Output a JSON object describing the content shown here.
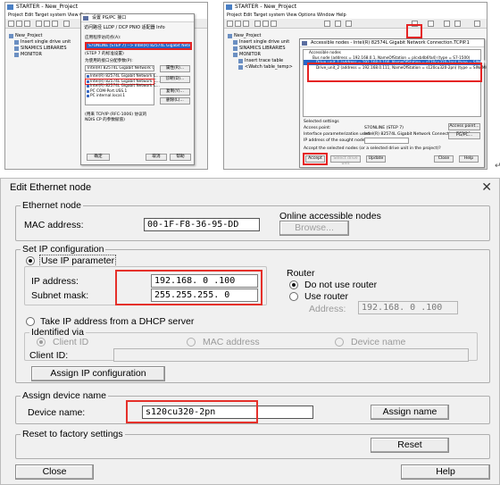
{
  "thumb_left": {
    "app_title": "STARTER - New_Project",
    "menu": "Project  Edit  Target system  View  Options",
    "tree": [
      "New_Project",
      "Insert single drive unit",
      "SINAMICS LIBRARIES",
      "MONITOR"
    ],
    "dialog_title": "设置 PG/PC 接口",
    "tabs": "访问路径  LLDP / DCP  PNIO 适配器  Info",
    "access_point_label": "应用程序访问点(A):",
    "access_point_value": "S7ONLINE (STEP 7)    --> Intel(R) 82574L Gigabit Network Conn",
    "std_label": "(STEP 7 的标准设置)",
    "param_label": "为使用的接口分配参数(P):",
    "param_value": "Intel(R) 82574L Gigabit Network Connect",
    "list_items": [
      "Intel(R) 82574L Gigabit Network C...",
      "Intel(R) 82574L Gigabit Network C...",
      "Intel(R) 82574L Gigabit Network C...",
      "PC COM-Port.USS.1",
      "PC internal.local.1"
    ],
    "side_buttons": [
      "属性(R)...",
      "诊断(D)...",
      "复制(Y)...",
      "删除(L)..."
    ],
    "desc": "(用来 TCP/IP (RFC-1006) 协议的 NDIS CP 的参数赋值)",
    "ok": "确定",
    "cancel": "取消",
    "help": "帮助"
  },
  "thumb_right": {
    "app_title": "STARTER - New_Project",
    "menu": "Project  Edit  Target system  View  Options  Window  Help",
    "tree": [
      "New_Project",
      "Insert single drive unit",
      "SINAMICS LIBRARIES",
      "MONITOR",
      "Insert trace table",
      "<Watch table_temp>"
    ],
    "dialog_title": "Accessible nodes - Intel(R) 82574L Gigabit Network Connection.TCPIP.1",
    "nodes": [
      "Accessible nodes",
      "Bus node (address = 192.168.0.1, NameOfStation = plcxb4b6fa4) (type = S7-1500)",
      "Drive_unit_1 (address = 192.168.0.100, NameOfStation = s120cu320-2pn) (type = SINAMICS S120/CU320-2PN V5.2)",
      "Drive_unit_2 (address = 192.168.0.111, NameOfStation = s120cu320-2pn) (type = SINAMICS S120/CU320-2PN V5.2)"
    ],
    "settings_title": "Selected settings",
    "access_point_label": "Access point:",
    "access_point_value": "S7ONLINE (STEP 7)",
    "iface_label": "Interface parameterization used:",
    "iface_value": "Intel(R) 82574L Gigabit Network Connection.TCPIP.1",
    "ip_label": "IP address of the sought node:",
    "question": "Accept the selected nodes (or a selected drive unit in the project)?",
    "btn_access_point": "Access point...",
    "btn_pgpc": "PG/PC...",
    "btn_accept": "Accept",
    "btn_select_drive": "Select drive unit",
    "btn_update": "Update",
    "btn_close": "Close",
    "btn_help": "Help"
  },
  "dialog": {
    "title": "Edit Ethernet node",
    "ethernet_node": {
      "group_label": "Ethernet node",
      "mac_label": "MAC address:",
      "mac_value": "00-1F-F8-36-95-DD",
      "online_label": "Online accessible nodes",
      "browse_label": "Browse..."
    },
    "set_ip": {
      "group_label": "Set IP configuration",
      "use_ip_label": "Use IP parameter",
      "ip_label": "IP address:",
      "ip_value": "192.168. 0 .100",
      "mask_label": "Subnet mask:",
      "mask_value": "255.255.255. 0",
      "router_label": "Router",
      "no_router_label": "Do not use router",
      "use_router_label": "Use router",
      "router_address_label": "Address:",
      "router_address_value": "192.168. 0 .100",
      "dhcp_label": "Take IP address from a DHCP server",
      "identified_label": "Identified via",
      "client_id_radio": "Client ID",
      "mac_radio": "MAC address",
      "device_name_radio": "Device name",
      "client_id_label": "Client ID:",
      "client_id_value": "",
      "assign_ip_button": "Assign IP configuration"
    },
    "assign_name": {
      "group_label": "Assign device name",
      "device_name_label": "Device name:",
      "device_name_value": "s120cu320-2pn",
      "assign_button": "Assign name"
    },
    "reset": {
      "group_label": "Reset to factory settings",
      "reset_button": "Reset"
    },
    "close_button": "Close",
    "help_button": "Help"
  },
  "colors": {
    "highlight": "#e5302a",
    "selection": "#2867c9"
  }
}
